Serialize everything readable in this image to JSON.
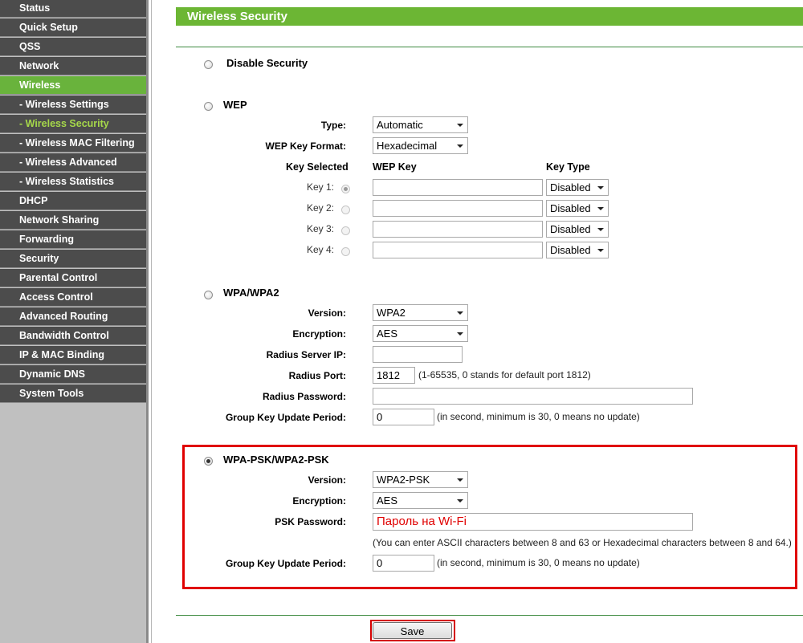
{
  "sidebar": {
    "items": [
      {
        "label": "Status",
        "state": "normal"
      },
      {
        "label": "Quick Setup",
        "state": "normal"
      },
      {
        "label": "QSS",
        "state": "normal"
      },
      {
        "label": "Network",
        "state": "normal"
      },
      {
        "label": "Wireless",
        "state": "active"
      },
      {
        "label": "- Wireless Settings",
        "state": "normal"
      },
      {
        "label": "- Wireless Security",
        "state": "current"
      },
      {
        "label": "- Wireless MAC Filtering",
        "state": "normal"
      },
      {
        "label": "- Wireless Advanced",
        "state": "normal"
      },
      {
        "label": "- Wireless Statistics",
        "state": "normal"
      },
      {
        "label": "DHCP",
        "state": "normal"
      },
      {
        "label": "Network Sharing",
        "state": "normal"
      },
      {
        "label": "Forwarding",
        "state": "normal"
      },
      {
        "label": "Security",
        "state": "normal"
      },
      {
        "label": "Parental Control",
        "state": "normal"
      },
      {
        "label": "Access Control",
        "state": "normal"
      },
      {
        "label": "Advanced Routing",
        "state": "normal"
      },
      {
        "label": "Bandwidth Control",
        "state": "normal"
      },
      {
        "label": "IP & MAC Binding",
        "state": "normal"
      },
      {
        "label": "Dynamic DNS",
        "state": "normal"
      },
      {
        "label": "System Tools",
        "state": "normal"
      }
    ]
  },
  "page": {
    "title": "Wireless Security"
  },
  "disable": {
    "label": "Disable Security",
    "selected": false
  },
  "wep": {
    "label": "WEP",
    "selected": false,
    "type_label": "Type:",
    "type_value": "Automatic",
    "format_label": "WEP Key Format:",
    "format_value": "Hexadecimal",
    "col_selected": "Key Selected",
    "col_key": "WEP Key",
    "col_type": "Key Type",
    "keys": [
      {
        "label": "Key 1:",
        "value": "",
        "type": "Disabled",
        "selected": true
      },
      {
        "label": "Key 2:",
        "value": "",
        "type": "Disabled",
        "selected": false
      },
      {
        "label": "Key 3:",
        "value": "",
        "type": "Disabled",
        "selected": false
      },
      {
        "label": "Key 4:",
        "value": "",
        "type": "Disabled",
        "selected": false
      }
    ]
  },
  "wpa": {
    "label": "WPA/WPA2",
    "selected": false,
    "version_label": "Version:",
    "version_value": "WPA2",
    "encryption_label": "Encryption:",
    "encryption_value": "AES",
    "radius_ip_label": "Radius Server IP:",
    "radius_ip_value": "",
    "radius_port_label": "Radius Port:",
    "radius_port_value": "1812",
    "radius_port_note": "(1-65535, 0 stands for default port 1812)",
    "radius_password_label": "Radius Password:",
    "radius_password_value": "",
    "gkup_label": "Group Key Update Period:",
    "gkup_value": "0",
    "gkup_note": "(in second, minimum is 30, 0 means no update)"
  },
  "psk": {
    "label": "WPA-PSK/WPA2-PSK",
    "selected": true,
    "version_label": "Version:",
    "version_value": "WPA2-PSK",
    "encryption_label": "Encryption:",
    "encryption_value": "AES",
    "password_label": "PSK Password:",
    "password_value": "Пароль на Wi-Fi",
    "password_note": "(You can enter ASCII characters between 8 and 63 or Hexadecimal characters between 8 and 64.)",
    "gkup_label": "Group Key Update Period:",
    "gkup_value": "0",
    "gkup_note": "(in second, minimum is 30, 0 means no update)"
  },
  "actions": {
    "save_label": "Save"
  },
  "colors": {
    "brand_green": "#6cb634",
    "sidebar_bg": "#4c4c4c",
    "highlight": "#e00000",
    "current_text": "#a6d84a"
  }
}
